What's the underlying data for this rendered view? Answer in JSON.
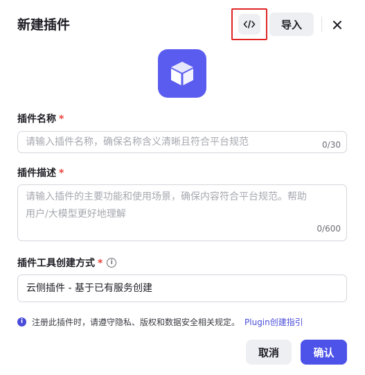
{
  "dialog": {
    "title": "新建插件",
    "import_label": "导入"
  },
  "form": {
    "name": {
      "label": "插件名称",
      "required_mark": "*",
      "placeholder": "请输入插件名称，确保名称含义清晰且符合平台规范",
      "counter": "0/30"
    },
    "description": {
      "label": "插件描述",
      "required_mark": "*",
      "placeholder_line1": "请输入插件的主要功能和使用场景，确保内容符合平台规范。帮助",
      "placeholder_line2": "用户/大模型更好地理解",
      "counter": "0/600"
    },
    "creation_method": {
      "label": "插件工具创建方式",
      "required_mark": "*",
      "info_glyph": "i",
      "value": "云侧插件 - 基于已有服务创建"
    }
  },
  "notice": {
    "icon_glyph": "i",
    "text": "注册此插件时，请遵守隐私、版权和数据安全相关规定。",
    "link": "Plugin创建指引"
  },
  "footer": {
    "cancel_label": "取消",
    "confirm_label": "确认"
  },
  "colors": {
    "accent": "#4d53e8",
    "plugin_icon_bg": "#5a5cf0",
    "required": "#e9423a",
    "highlight_box": "#e02424"
  },
  "icons": {
    "code": "code-icon",
    "close": "close-icon",
    "plugin": "cube-icon",
    "info": "info-icon"
  }
}
